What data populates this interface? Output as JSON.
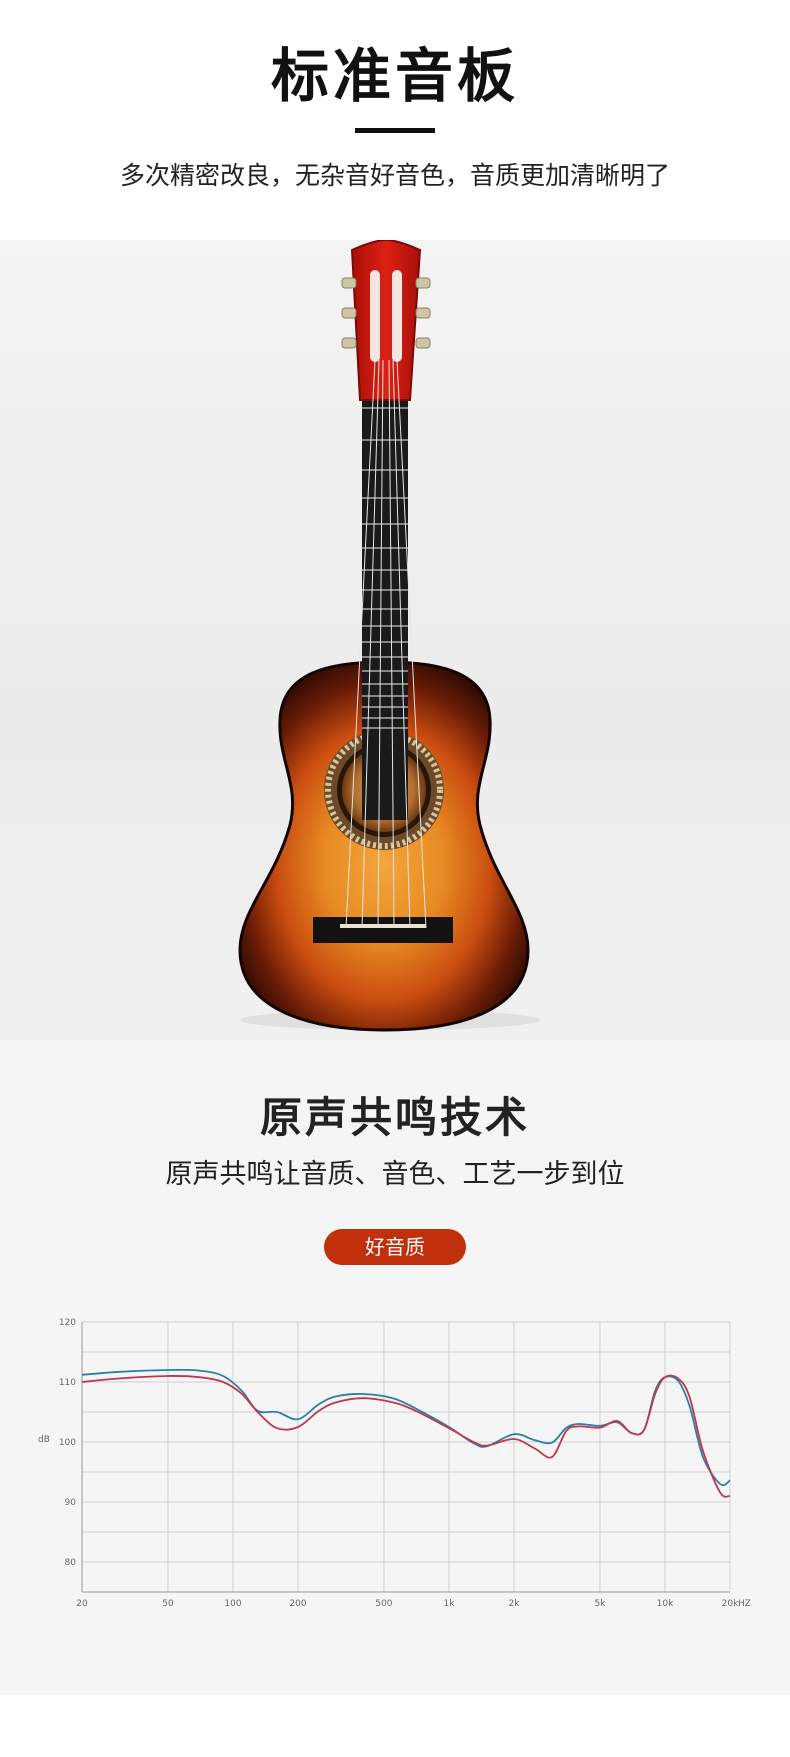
{
  "header": {
    "title": "标准音板",
    "subtitle": "多次精密改良，无杂音好音色，音质更加清晰明了"
  },
  "feature": {
    "title": "原声共鸣技术",
    "subtitle": "原声共鸣让音质、音色、工艺一步到位",
    "badge": "好音质"
  },
  "colors": {
    "badge": "#c1300d",
    "headstock": "#c8160f",
    "series_red": "#c0384a",
    "series_blue": "#2a7fa8"
  },
  "chart_data": {
    "type": "line",
    "xscale": "log",
    "xlim": [
      20,
      20000
    ],
    "ylim": [
      75,
      120
    ],
    "grid": true,
    "y_ticks": [
      "120",
      "110",
      "100",
      "90",
      "80"
    ],
    "x_ticks": [
      "20",
      "50",
      "100",
      "200",
      "500",
      "1k",
      "2k",
      "5k",
      "10k",
      "20k"
    ],
    "x_unit": "HZ",
    "ylabel": "dB",
    "series": [
      {
        "color": "#2a7fa8",
        "points": [
          [
            20,
            111.2
          ],
          [
            30,
            111.7
          ],
          [
            50,
            112.0
          ],
          [
            70,
            111.9
          ],
          [
            90,
            111.0
          ],
          [
            110,
            108.5
          ],
          [
            130,
            105.2
          ],
          [
            160,
            105.0
          ],
          [
            200,
            103.8
          ],
          [
            250,
            106.3
          ],
          [
            300,
            107.6
          ],
          [
            400,
            108.0
          ],
          [
            550,
            107.3
          ],
          [
            700,
            105.6
          ],
          [
            1000,
            102.5
          ],
          [
            1300,
            99.8
          ],
          [
            1500,
            99.3
          ],
          [
            2000,
            101.3
          ],
          [
            2500,
            100.3
          ],
          [
            3000,
            99.9
          ],
          [
            3500,
            102.4
          ],
          [
            4000,
            103.0
          ],
          [
            5000,
            102.7
          ],
          [
            6000,
            103.3
          ],
          [
            7000,
            101.5
          ],
          [
            8000,
            102.0
          ],
          [
            9000,
            108.5
          ],
          [
            10000,
            110.8
          ],
          [
            11500,
            110.2
          ],
          [
            13000,
            106.0
          ],
          [
            15000,
            97.5
          ],
          [
            18000,
            93.0
          ],
          [
            20000,
            93.6
          ]
        ]
      },
      {
        "color": "#c0384a",
        "points": [
          [
            20,
            110.0
          ],
          [
            30,
            110.6
          ],
          [
            50,
            111.0
          ],
          [
            70,
            110.8
          ],
          [
            90,
            110.0
          ],
          [
            110,
            108.0
          ],
          [
            130,
            105.0
          ],
          [
            160,
            102.3
          ],
          [
            200,
            102.5
          ],
          [
            250,
            105.2
          ],
          [
            300,
            106.6
          ],
          [
            400,
            107.3
          ],
          [
            550,
            106.6
          ],
          [
            700,
            105.2
          ],
          [
            1000,
            102.3
          ],
          [
            1300,
            100.0
          ],
          [
            1500,
            99.4
          ],
          [
            2000,
            100.5
          ],
          [
            2500,
            98.9
          ],
          [
            3000,
            97.5
          ],
          [
            3500,
            101.9
          ],
          [
            4000,
            102.6
          ],
          [
            5000,
            102.4
          ],
          [
            6000,
            103.5
          ],
          [
            7000,
            101.5
          ],
          [
            8000,
            102.0
          ],
          [
            9000,
            108.0
          ],
          [
            10000,
            110.8
          ],
          [
            11500,
            110.6
          ],
          [
            13000,
            107.5
          ],
          [
            15000,
            98.5
          ],
          [
            18000,
            91.6
          ],
          [
            20000,
            91.0
          ]
        ]
      }
    ]
  }
}
